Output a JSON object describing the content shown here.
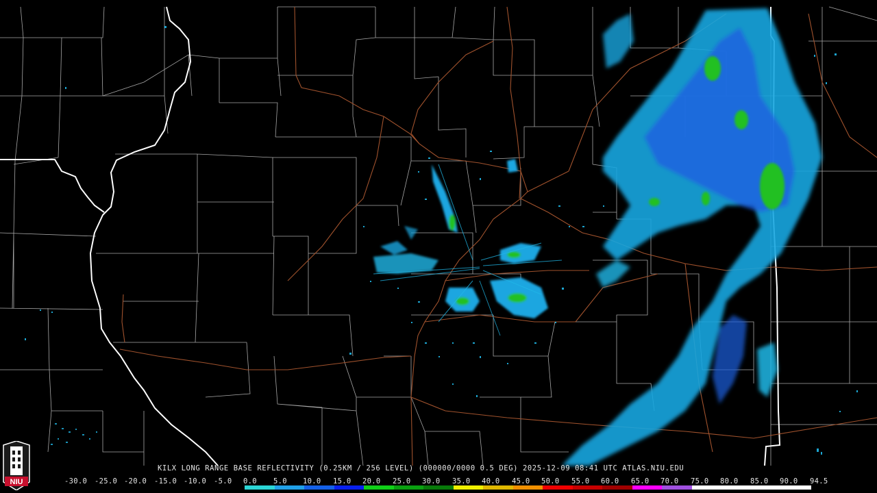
{
  "radar": {
    "caption": "KILX LONG RANGE BASE REFLECTIVITY (0.25KM / 256 LEVEL) (000000/0000 0.5 DEG) 2025-12-09 08:41 UTC  ATLAS.NIU.EDU",
    "logo_text": "NIU"
  },
  "scale": {
    "labels": [
      "-30.0",
      "-25.0",
      "-20.0",
      "-15.0",
      "-10.0",
      "-5.0",
      "0.0",
      "5.0",
      "10.0",
      "15.0",
      "20.0",
      "25.0",
      "30.0",
      "35.0",
      "40.0",
      "45.0",
      "50.0",
      "55.0",
      "60.0",
      "65.0",
      "70.0",
      "75.0",
      "80.0",
      "85.0",
      "90.0",
      "94.5"
    ],
    "colors": [
      "#000000",
      "#000000",
      "#000000",
      "#000000",
      "#000000",
      "#000000",
      "#2bd6d6",
      "#20a0e8",
      "#1460e8",
      "#0820f0",
      "#10d018",
      "#0aa010",
      "#087a0a",
      "#f0f000",
      "#e0b800",
      "#f09000",
      "#f00000",
      "#c80000",
      "#a00000",
      "#ff00ff",
      "#a050e0",
      "#ffffff",
      "#ffffff",
      "#ffffff",
      "#ffffff"
    ]
  }
}
